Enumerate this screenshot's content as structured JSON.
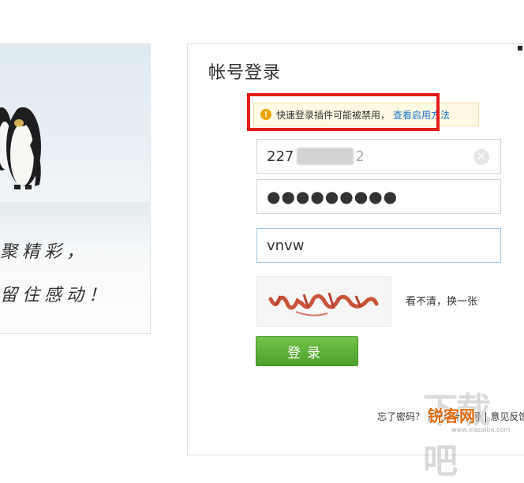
{
  "promo": {
    "slogan_line1": "聚精彩，",
    "slogan_line2": "留住感动！"
  },
  "login": {
    "title": "帐号登录",
    "hint": {
      "text": "快速登录插件可能被禁用，",
      "link": "查看启用方法",
      "icon": "warning-icon"
    },
    "username": {
      "prefix": "227",
      "suffix": "2"
    },
    "password": {
      "masked": "●●●●●●●●●"
    },
    "captcha_input": {
      "value": "vnvw"
    },
    "captcha_image_text": "vnvw",
    "refresh_label": "看不清，换一张",
    "submit_label": "登录",
    "bottom_links": "忘了密码？ | 注册新帐号 | 意见反馈"
  },
  "watermark": {
    "big": "下载吧",
    "brand": "锐客网",
    "url": "www.xiazaiba.com"
  },
  "colors": {
    "highlight_box": "#e31b1b",
    "submit_green": "#5bb035",
    "link_blue": "#1a73c8"
  }
}
